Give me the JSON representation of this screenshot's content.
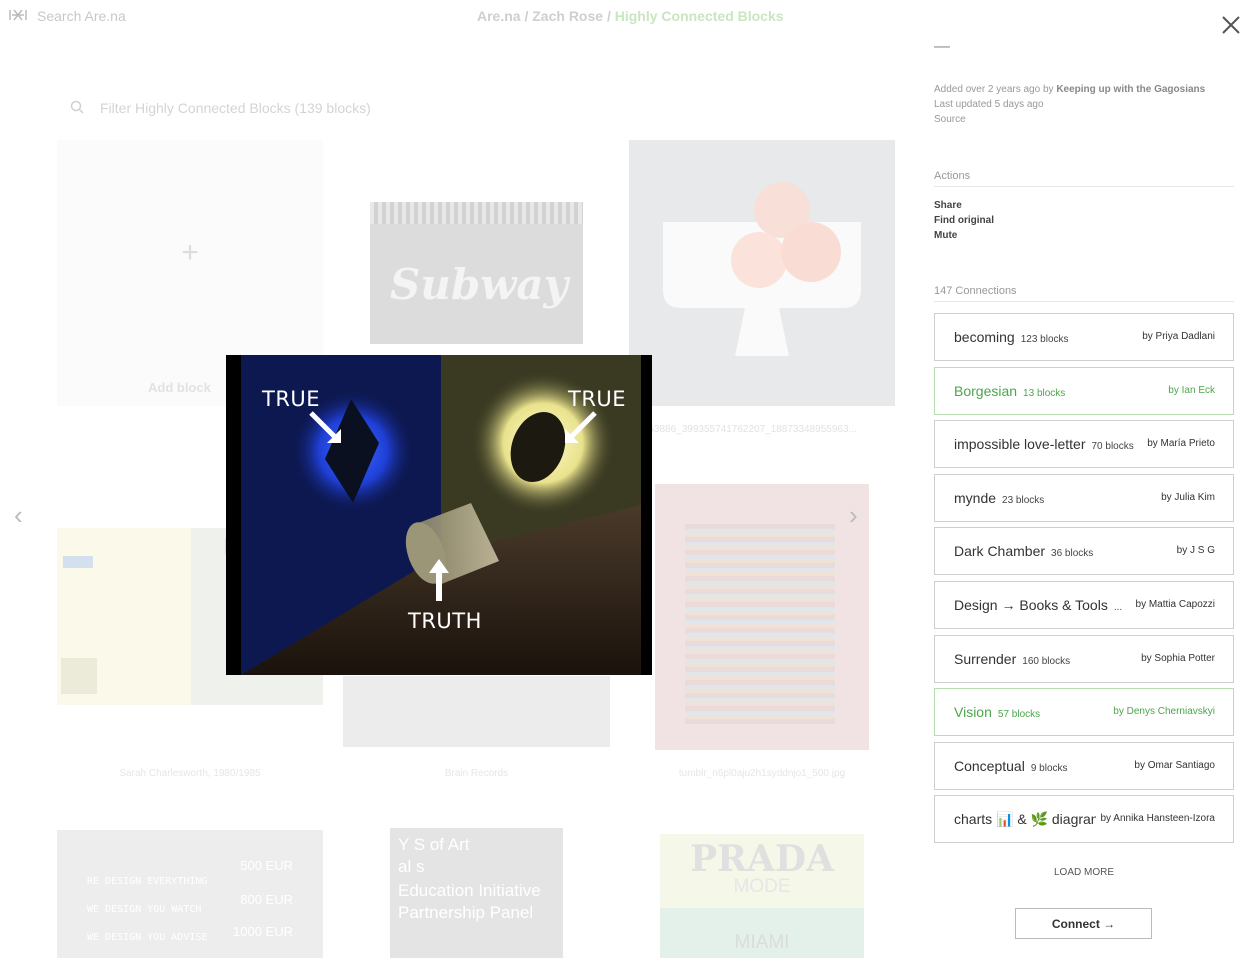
{
  "topbar": {
    "logo": "ᵒᵒ",
    "search_placeholder": "Search Are.na",
    "breadcrumb_site": "Are.na",
    "breadcrumb_user": "Zach Rose",
    "breadcrumb_separator": "/",
    "breadcrumb_channel": "Highly Connected Blocks"
  },
  "channel": {
    "filter_placeholder": "Filter Highly Connected Blocks (139 blocks)",
    "add_block_label": "Add block",
    "add_icon": "+",
    "prev_arrow": "‹",
    "next_arrow": "›",
    "tiles": {
      "subway_text": "Subway",
      "cake_caption": "...63886_399355741762207_18873348955963...",
      "prints_caption": "Sarah Charlesworth, 1980/1985",
      "brain_caption": "Brain Records",
      "tumblr_caption": "tumblr_n6pl0aju2h1syddnjo1_500.jpg",
      "wall_lines": [
        "RE DESIGN EVERYTHING",
        "WE DESIGN YOU WATCH",
        "WE DESIGN YOU ADVISE"
      ],
      "wall_prices": [
        "500 EUR",
        "800 EUR",
        "1000 EUR"
      ],
      "poster_lines": [
        "Y  S  of Art",
        "al  s",
        "Education Initiative",
        "Partnership Panel"
      ],
      "prada_title": "PRADA",
      "prada_sub": "MODE",
      "prada_city": "MIAMI"
    }
  },
  "lightbox": {
    "label_left": "TRUE",
    "label_right": "TRUE",
    "label_bottom": "TRUTH"
  },
  "sidebar": {
    "dash": "—",
    "added_prefix": "Added over 2 years ago by",
    "added_by": "Keeping up with the Gagosians",
    "last_updated": "Last updated 5 days ago",
    "source": "Source",
    "actions_title": "Actions",
    "actions": [
      "Share",
      "Find original",
      "Mute"
    ],
    "connections_title": "147 Connections",
    "connections": [
      {
        "title": "becoming",
        "count": "123 blocks",
        "by": "by Priya Dadlani",
        "green": false
      },
      {
        "title": "Borgesian",
        "count": "13 blocks",
        "by": "by Ian Eck",
        "green": true
      },
      {
        "title": "impossible love-letter",
        "count": "70 blocks",
        "by": "by María Prieto",
        "green": false
      },
      {
        "title": "mynde",
        "count": "23 blocks",
        "by": "by Julia Kim",
        "green": false
      },
      {
        "title": "Dark Chamber",
        "count": "36 blocks",
        "by": "by J S G",
        "green": false
      },
      {
        "title": "Design → Books & Tools",
        "count": "...",
        "by": "by Mattia Capozzi",
        "green": false
      },
      {
        "title": "Surrender",
        "count": "160 blocks",
        "by": "by Sophia Potter",
        "green": false
      },
      {
        "title": "Vision",
        "count": "57 blocks",
        "by": "by Denys Cherniavskyi",
        "green": true
      },
      {
        "title": "Conceptual",
        "count": "9 blocks",
        "by": "by Omar Santiago",
        "green": false
      },
      {
        "title": "charts 📊 & 🌿 diagran",
        "count": "",
        "by": "by Annika Hansteen-Izora",
        "green": false
      }
    ],
    "load_more": "LOAD MORE",
    "connect_label": "Connect →"
  }
}
